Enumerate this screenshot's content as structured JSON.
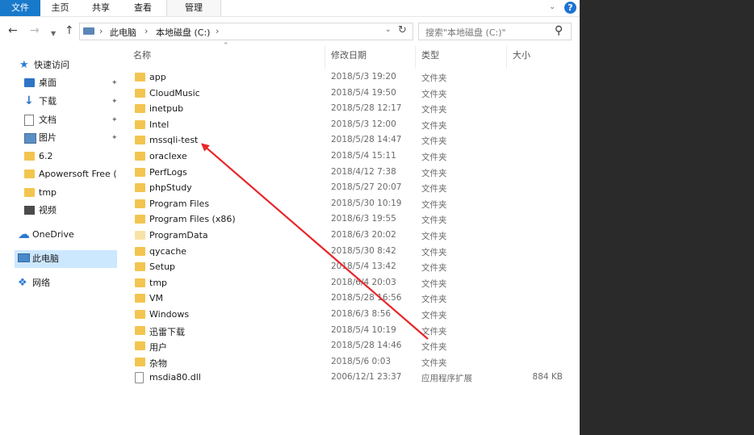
{
  "ribbon": {
    "tabs": [
      "文件",
      "主页",
      "共享",
      "查看",
      "管理"
    ]
  },
  "address": {
    "crumbs": [
      "此电脑",
      "本地磁盘 (C:)"
    ],
    "search_placeholder": "搜索\"本地磁盘 (C:)\""
  },
  "nav": {
    "quick_access": "快速访问",
    "items": [
      "桌面",
      "下载",
      "文档",
      "图片",
      "6.2",
      "Apowersoft Free (",
      "tmp",
      "视频"
    ],
    "onedrive": "OneDrive",
    "this_pc": "此电脑",
    "network": "网络"
  },
  "columns": {
    "name": "名称",
    "date": "修改日期",
    "type": "类型",
    "size": "大小"
  },
  "files": [
    {
      "name": "app",
      "date": "2018/5/3 19:20",
      "type": "文件夹",
      "size": ""
    },
    {
      "name": "CloudMusic",
      "date": "2018/5/4 19:50",
      "type": "文件夹",
      "size": ""
    },
    {
      "name": "inetpub",
      "date": "2018/5/28 12:17",
      "type": "文件夹",
      "size": ""
    },
    {
      "name": "Intel",
      "date": "2018/5/3 12:00",
      "type": "文件夹",
      "size": ""
    },
    {
      "name": "mssqli-test",
      "date": "2018/5/28 14:47",
      "type": "文件夹",
      "size": ""
    },
    {
      "name": "oraclexe",
      "date": "2018/5/4 15:11",
      "type": "文件夹",
      "size": ""
    },
    {
      "name": "PerfLogs",
      "date": "2018/4/12 7:38",
      "type": "文件夹",
      "size": ""
    },
    {
      "name": "phpStudy",
      "date": "2018/5/27 20:07",
      "type": "文件夹",
      "size": ""
    },
    {
      "name": "Program Files",
      "date": "2018/5/30 10:19",
      "type": "文件夹",
      "size": ""
    },
    {
      "name": "Program Files (x86)",
      "date": "2018/6/3 19:55",
      "type": "文件夹",
      "size": ""
    },
    {
      "name": "ProgramData",
      "date": "2018/6/3 20:02",
      "type": "文件夹",
      "size": ""
    },
    {
      "name": "qycache",
      "date": "2018/5/30 8:42",
      "type": "文件夹",
      "size": ""
    },
    {
      "name": "Setup",
      "date": "2018/5/4 13:42",
      "type": "文件夹",
      "size": ""
    },
    {
      "name": "tmp",
      "date": "2018/6/4 20:03",
      "type": "文件夹",
      "size": ""
    },
    {
      "name": "VM",
      "date": "2018/5/28 16:56",
      "type": "文件夹",
      "size": ""
    },
    {
      "name": "Windows",
      "date": "2018/6/3 8:56",
      "type": "文件夹",
      "size": ""
    },
    {
      "name": "迅雷下载",
      "date": "2018/5/4 10:19",
      "type": "文件夹",
      "size": ""
    },
    {
      "name": "用户",
      "date": "2018/5/28 14:46",
      "type": "文件夹",
      "size": ""
    },
    {
      "name": "杂物",
      "date": "2018/5/6 0:03",
      "type": "文件夹",
      "size": ""
    },
    {
      "name": "msdia80.dll",
      "date": "2006/12/1 23:37",
      "type": "应用程序扩展",
      "size": "884 KB"
    }
  ],
  "annotation_color": "#e8262a"
}
